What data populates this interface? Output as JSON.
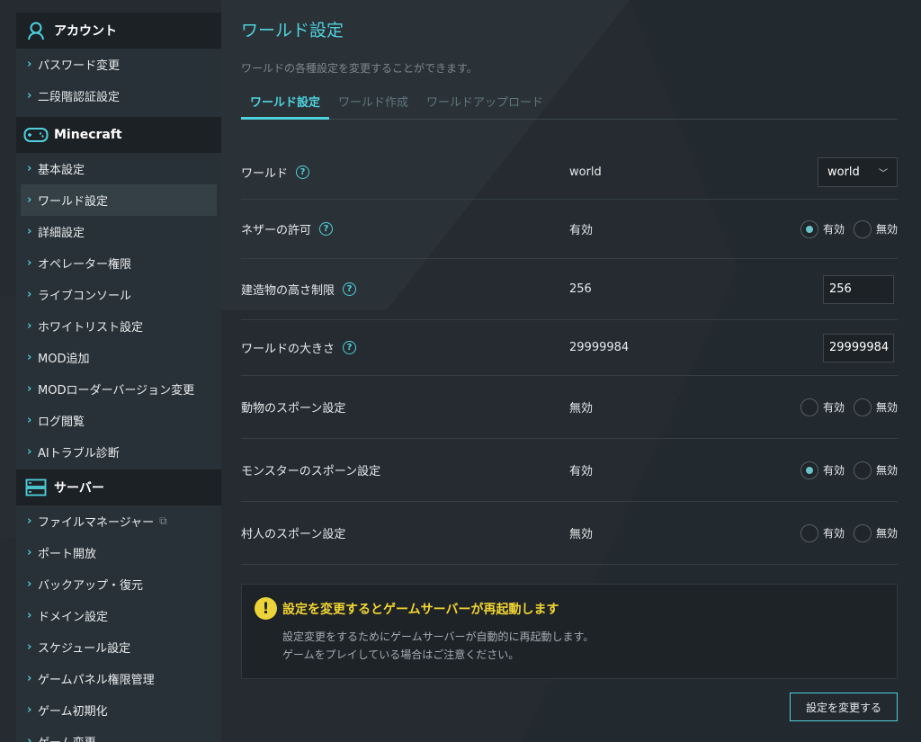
{
  "sidebar": {
    "sections": [
      {
        "title": "アカウント",
        "icon": "user-icon",
        "items": [
          {
            "label": "パスワード変更"
          },
          {
            "label": "二段階認証設定"
          }
        ]
      },
      {
        "title": "Minecraft",
        "icon": "gamepad-icon",
        "items": [
          {
            "label": "基本設定"
          },
          {
            "label": "ワールド設定",
            "active": true
          },
          {
            "label": "詳細設定"
          },
          {
            "label": "オペレーター権限"
          },
          {
            "label": "ライブコンソール"
          },
          {
            "label": "ホワイトリスト設定"
          },
          {
            "label": "MOD追加"
          },
          {
            "label": "MODローダーバージョン変更"
          },
          {
            "label": "ログ閲覧"
          },
          {
            "label": "AIトラブル診断"
          }
        ]
      },
      {
        "title": "サーバー",
        "icon": "server-icon",
        "items": [
          {
            "label": "ファイルマネージャー",
            "external": true
          },
          {
            "label": "ポート開放"
          },
          {
            "label": "バックアップ・復元"
          },
          {
            "label": "ドメイン設定"
          },
          {
            "label": "スケジュール設定"
          },
          {
            "label": "ゲームパネル権限管理"
          },
          {
            "label": "ゲーム初期化"
          },
          {
            "label": "ゲーム変更"
          }
        ]
      }
    ]
  },
  "main": {
    "title": "ワールド設定",
    "description": "ワールドの各種設定を変更することができます。",
    "tabs": [
      {
        "label": "ワールド設定",
        "active": true
      },
      {
        "label": "ワールド作成"
      },
      {
        "label": "ワールドアップロード"
      }
    ],
    "settings": [
      {
        "label": "ワールド",
        "help": true,
        "value": "world",
        "control": "select",
        "selected": "world"
      },
      {
        "label": "ネザーの許可",
        "help": true,
        "value": "有効",
        "control": "radio",
        "options": [
          "有効",
          "無効"
        ],
        "checked": "有効"
      },
      {
        "label": "建造物の高さ制限",
        "help": true,
        "value": "256",
        "control": "input",
        "input_value": "256"
      },
      {
        "label": "ワールドの大きさ",
        "help": true,
        "value": "29999984",
        "control": "input",
        "input_value": "29999984"
      },
      {
        "label": "動物のスポーン設定",
        "help": false,
        "value": "無効",
        "control": "radio",
        "options": [
          "有効",
          "無効"
        ],
        "checked": null
      },
      {
        "label": "モンスターのスポーン設定",
        "help": false,
        "value": "有効",
        "control": "radio",
        "options": [
          "有効",
          "無効"
        ],
        "checked": "有効"
      },
      {
        "label": "村人のスポーン設定",
        "help": false,
        "value": "無効",
        "control": "radio",
        "options": [
          "有効",
          "無効"
        ],
        "checked": null
      }
    ],
    "help_glyph": "?",
    "notice": {
      "icon_glyph": "!",
      "title": "設定を変更するとゲームサーバーが再起動します",
      "lines": [
        "設定変更をするためにゲームサーバーが自動的に再起動します。",
        "ゲームをプレイしている場合はご注意ください。"
      ]
    },
    "submit_label": "設定を変更する"
  },
  "colors": {
    "accent": "#4fd1dc",
    "warning": "#ecd33a",
    "background": "#252b30",
    "sidebar_bg": "#283137"
  }
}
